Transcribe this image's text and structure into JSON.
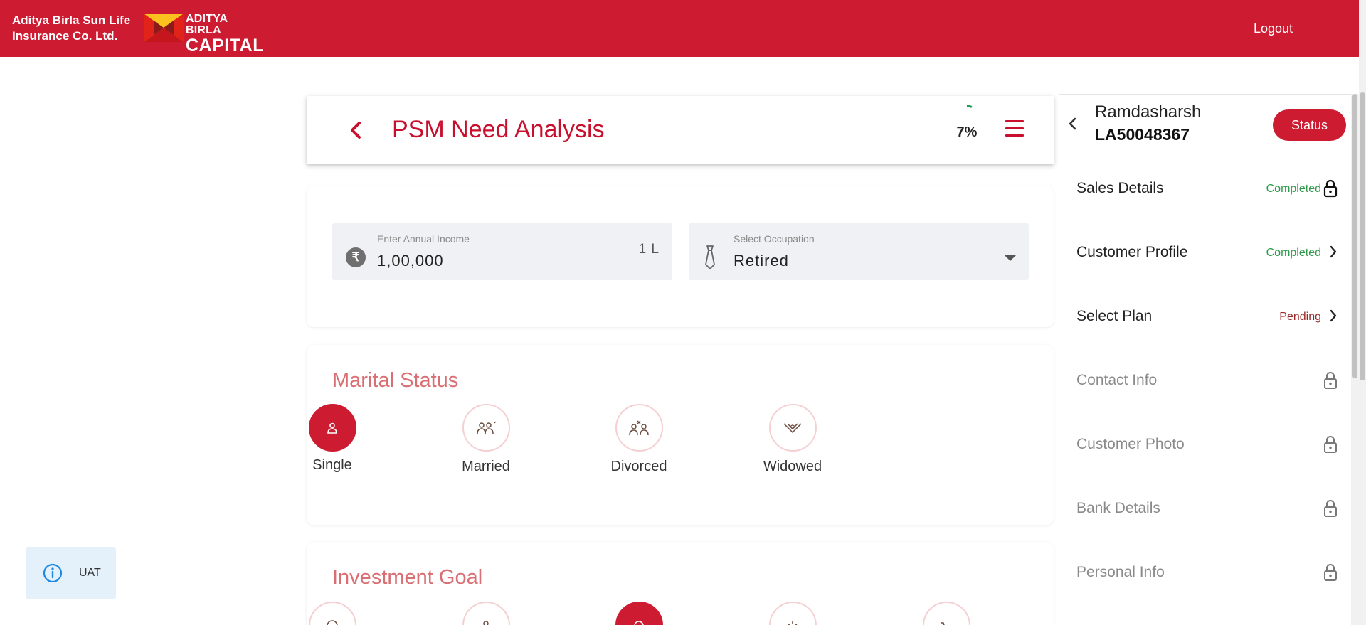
{
  "header": {
    "brand_line1": "Aditya Birla Sun Life",
    "brand_line2": "Insurance Co. Ltd.",
    "logo_line1": "ADITYA BIRLA",
    "logo_line2": "CAPITAL",
    "logout_label": "Logout",
    "brand_color": "#cd1c32"
  },
  "title_bar": {
    "back_icon": "chevron-left-icon",
    "title": "PSM Need Analysis",
    "progress_percent": 7,
    "progress_label": "7%",
    "menu_icon": "hamburger-menu-icon"
  },
  "income_field": {
    "label": "Enter Annual Income",
    "value": "1,00,000",
    "unit": "1 L",
    "icon": "rupee-icon"
  },
  "occupation_field": {
    "label": "Select Occupation",
    "value": "Retired",
    "icon": "tie-icon"
  },
  "marital_status": {
    "title": "Marital Status",
    "options": [
      {
        "label": "Single",
        "icon": "single-person-icon",
        "selected": true
      },
      {
        "label": "Married",
        "icon": "married-couple-icon",
        "selected": false
      },
      {
        "label": "Divorced",
        "icon": "divorced-couple-icon",
        "selected": false
      },
      {
        "label": "Widowed",
        "icon": "widowed-icon",
        "selected": false
      }
    ]
  },
  "investment_goal": {
    "title": "Investment Goal",
    "options": [
      {
        "icon": "goal-icon-1",
        "selected": false
      },
      {
        "icon": "goal-icon-2",
        "selected": false
      },
      {
        "icon": "goal-icon-3",
        "selected": true
      },
      {
        "icon": "goal-icon-4",
        "selected": false
      },
      {
        "icon": "goal-icon-5",
        "selected": false
      }
    ]
  },
  "side_panel": {
    "customer_name": "Ramdasharsh",
    "application_id": "LA50048367",
    "status_label": "Status",
    "items": [
      {
        "label": "Sales Details",
        "state": "Completed",
        "icon": "lock-open-icon"
      },
      {
        "label": "Customer Profile",
        "state": "Completed",
        "icon": "chevron-right-icon"
      },
      {
        "label": "Select Plan",
        "state": "Pending",
        "icon": "chevron-right-icon"
      },
      {
        "label": "Contact Info",
        "state": "",
        "icon": "lock-icon"
      },
      {
        "label": "Customer Photo",
        "state": "",
        "icon": "lock-icon"
      },
      {
        "label": "Bank Details",
        "state": "",
        "icon": "lock-icon"
      },
      {
        "label": "Personal Info",
        "state": "",
        "icon": "lock-icon"
      }
    ]
  },
  "env_badge": {
    "label": "UAT",
    "icon": "info-icon"
  }
}
